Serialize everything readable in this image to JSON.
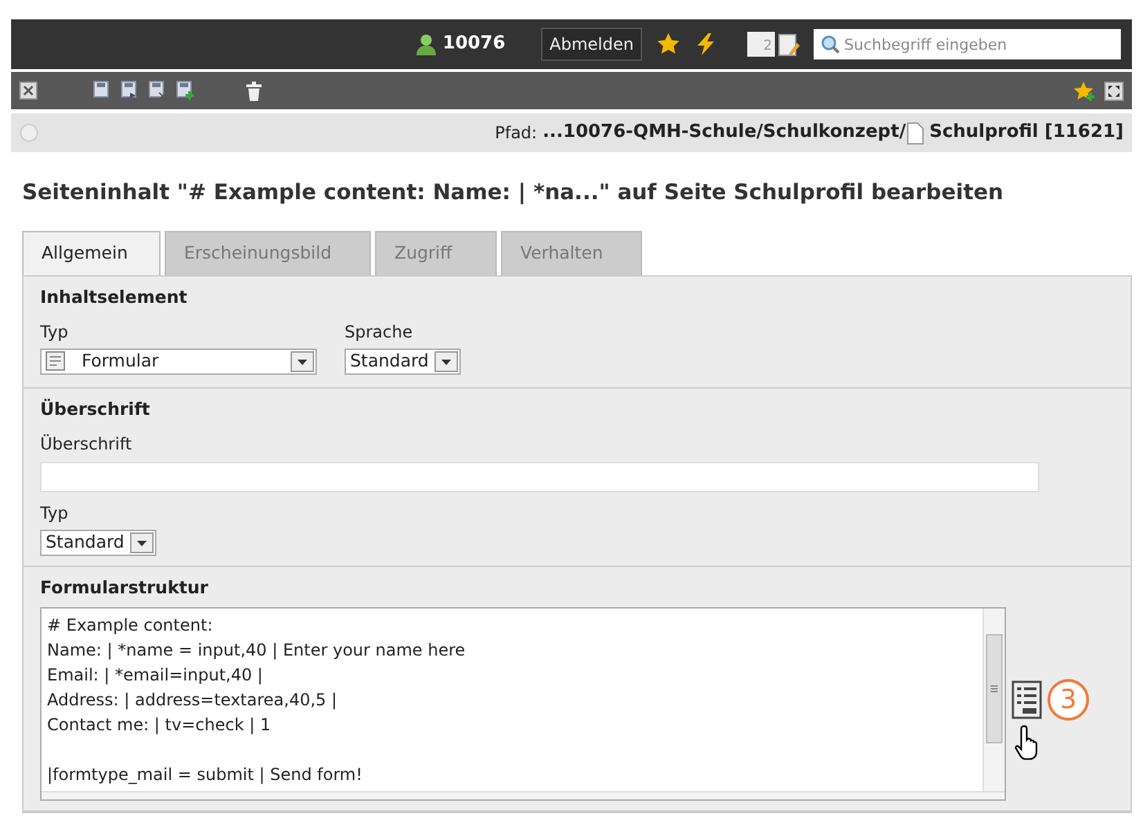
{
  "topbar": {
    "user": "10076",
    "logout": "Abmelden",
    "badge_count": "2",
    "search": {
      "placeholder": "Suchbegriff eingeben"
    }
  },
  "path": {
    "label": "Pfad:",
    "trail": "...10076-QMH-Schule/Schulkonzept/",
    "page": "Schulprofil [11621]"
  },
  "title": "Seiteninhalt \"# Example content: Name: | *na...\" auf Seite Schulprofil bearbeiten",
  "tabs": [
    {
      "label": "Allgemein",
      "selected": true
    },
    {
      "label": "Erscheinungsbild",
      "selected": false
    },
    {
      "label": "Zugriff",
      "selected": false
    },
    {
      "label": "Verhalten",
      "selected": false
    }
  ],
  "sections": [
    {
      "heading": "Inhaltselement",
      "fields": [
        {
          "kind": "select_icon",
          "label": "Typ",
          "value": "Formular"
        },
        {
          "kind": "select",
          "label": "Sprache",
          "value": "Standard"
        }
      ]
    },
    {
      "heading": "Überschrift",
      "fields": [
        {
          "kind": "text",
          "label": "Überschrift"
        },
        {
          "kind": "select",
          "label": "Typ",
          "value": "Standard"
        }
      ]
    },
    {
      "heading": "Formularstruktur",
      "fields": [
        {
          "kind": "code",
          "blocks": [
            [
              "# Example content:",
              "Name: | *name = input,40 | Enter your name here",
              "Email: | *email=input,40 |",
              "Address: | address=textarea,40,5 |",
              "Contact me: | tv=check | 1"
            ],
            [
              "|formtype_mail = submit | Send form!"
            ]
          ]
        }
      ]
    }
  ],
  "callout": "3"
}
